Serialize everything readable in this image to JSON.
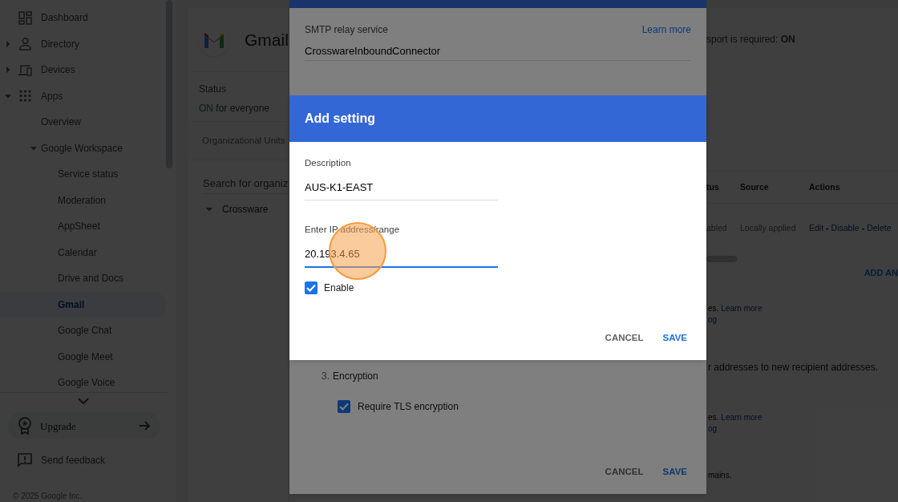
{
  "sidebar": {
    "items": [
      {
        "label": "Dashboard",
        "selected": false
      },
      {
        "label": "Directory",
        "expanded": false,
        "selected": false
      },
      {
        "label": "Devices",
        "expanded": false,
        "selected": false
      },
      {
        "label": "Apps",
        "expanded": true,
        "selected": false,
        "children": [
          {
            "label": "Overview",
            "selected": false
          },
          {
            "label": "Google Workspace",
            "expanded": true,
            "selected": false,
            "children": [
              {
                "label": "Service status",
                "selected": false
              },
              {
                "label": "Moderation",
                "selected": false
              },
              {
                "label": "AppSheet",
                "selected": false
              },
              {
                "label": "Calendar",
                "selected": false
              },
              {
                "label": "Drive and Docs",
                "selected": false
              },
              {
                "label": "Gmail",
                "selected": true
              },
              {
                "label": "Google Chat",
                "selected": false
              },
              {
                "label": "Google Meet",
                "selected": false
              },
              {
                "label": "Google Voice",
                "selected": false
              }
            ]
          }
        ]
      }
    ],
    "upgrade": "Upgrade",
    "feedback": "Send feedback",
    "copyright": "© 2025 Google Inc."
  },
  "app_header": {
    "title": "Gmail"
  },
  "status": {
    "label": "Status",
    "value": "ON",
    "on": true,
    "text": "for everyone"
  },
  "org_units": {
    "title": "Organizational Units",
    "search_placeholder": "Search for organiz",
    "tree": [
      {
        "label": "Crossware",
        "expanded": true
      }
    ]
  },
  "setting_line": "sport is required: **ON**",
  "table": {
    "columns": [
      "tus",
      "Source",
      "Actions"
    ],
    "rows": [
      {
        "cells": [
          "abled",
          "Locally applied"
        ],
        "actions": [
          {
            "label": "Edit",
            "kind": "link"
          },
          {
            "label": "-",
            "kind": "separator"
          },
          {
            "label": "Disable",
            "kind": "link"
          },
          {
            "label": "-",
            "kind": "separator"
          },
          {
            "label": "Delete",
            "kind": "link"
          }
        ]
      }
    ]
  },
  "add_button": "ADD AN",
  "fragments": [
    {
      "text": "es.",
      "link": "Learn more"
    },
    {
      "link": "og"
    },
    {
      "text": "r addresses to new recipient addresses."
    },
    {
      "text": "es.",
      "link": "Learn more"
    },
    {
      "link": "og"
    },
    {
      "text": "mains."
    }
  ],
  "relay_dialog": {
    "field_label": "SMTP relay service",
    "learn_more": "Learn more",
    "value": "CrosswareInboundConnector",
    "section": {
      "number": "3.",
      "title": "Encryption"
    },
    "require_tls": {
      "label": "Require TLS encryption",
      "checked": true
    },
    "buttons": [
      {
        "label": "CANCEL",
        "kind": "secondary"
      },
      {
        "label": "SAVE",
        "kind": "primary"
      }
    ]
  },
  "add_setting_dialog": {
    "title": "Add setting",
    "fields": [
      {
        "label": "Description",
        "value": "AUS-K1-EAST",
        "focused": false
      },
      {
        "label": "Enter IP address/range",
        "value": "20.193.4.65",
        "focused": true
      }
    ],
    "enable": {
      "label": "Enable",
      "checked": true
    },
    "buttons": [
      {
        "label": "CANCEL",
        "kind": "secondary"
      },
      {
        "label": "SAVE",
        "kind": "primary"
      }
    ]
  }
}
